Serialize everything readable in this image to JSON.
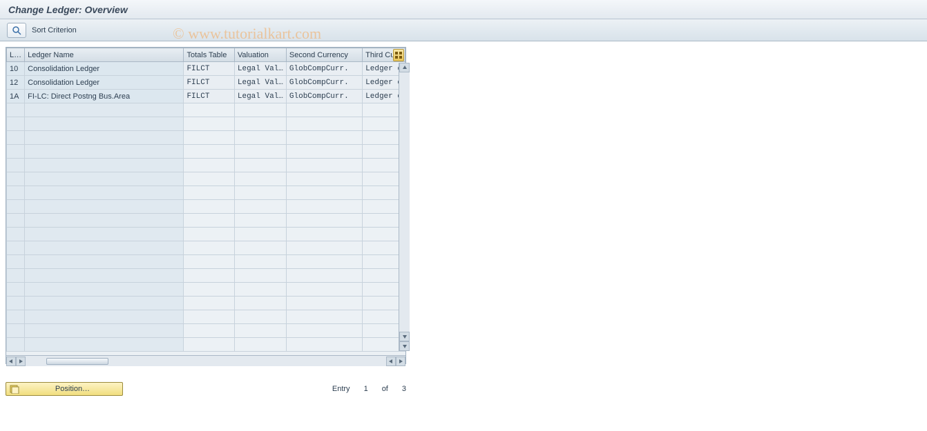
{
  "title": "Change Ledger: Overview",
  "toolbar": {
    "sort_label": "Sort Criterion"
  },
  "table": {
    "headers": {
      "l": "L…",
      "name": "Ledger Name",
      "tt": "Totals Table",
      "val": "Valuation",
      "sc": "Second Currency",
      "tc": "Third Cur"
    },
    "rows": [
      {
        "l": "10",
        "name": "Consolidation Ledger",
        "tt": "FILCT",
        "val": "Legal Val…",
        "sc": "GlobCompCurr.",
        "tc": "Ledger c"
      },
      {
        "l": "12",
        "name": "Consolidation Ledger",
        "tt": "FILCT",
        "val": "Legal Val…",
        "sc": "GlobCompCurr.",
        "tc": "Ledger c"
      },
      {
        "l": "1A",
        "name": "FI-LC: Direct Postng Bus.Area",
        "tt": "FILCT",
        "val": "Legal Val…",
        "sc": "GlobCompCurr.",
        "tc": "Ledger c"
      }
    ]
  },
  "footer": {
    "position_label": "Position…",
    "entry_label": "Entry",
    "entry_current": "1",
    "entry_of": "of",
    "entry_total": "3"
  },
  "watermark": "© www.tutorialkart.com"
}
